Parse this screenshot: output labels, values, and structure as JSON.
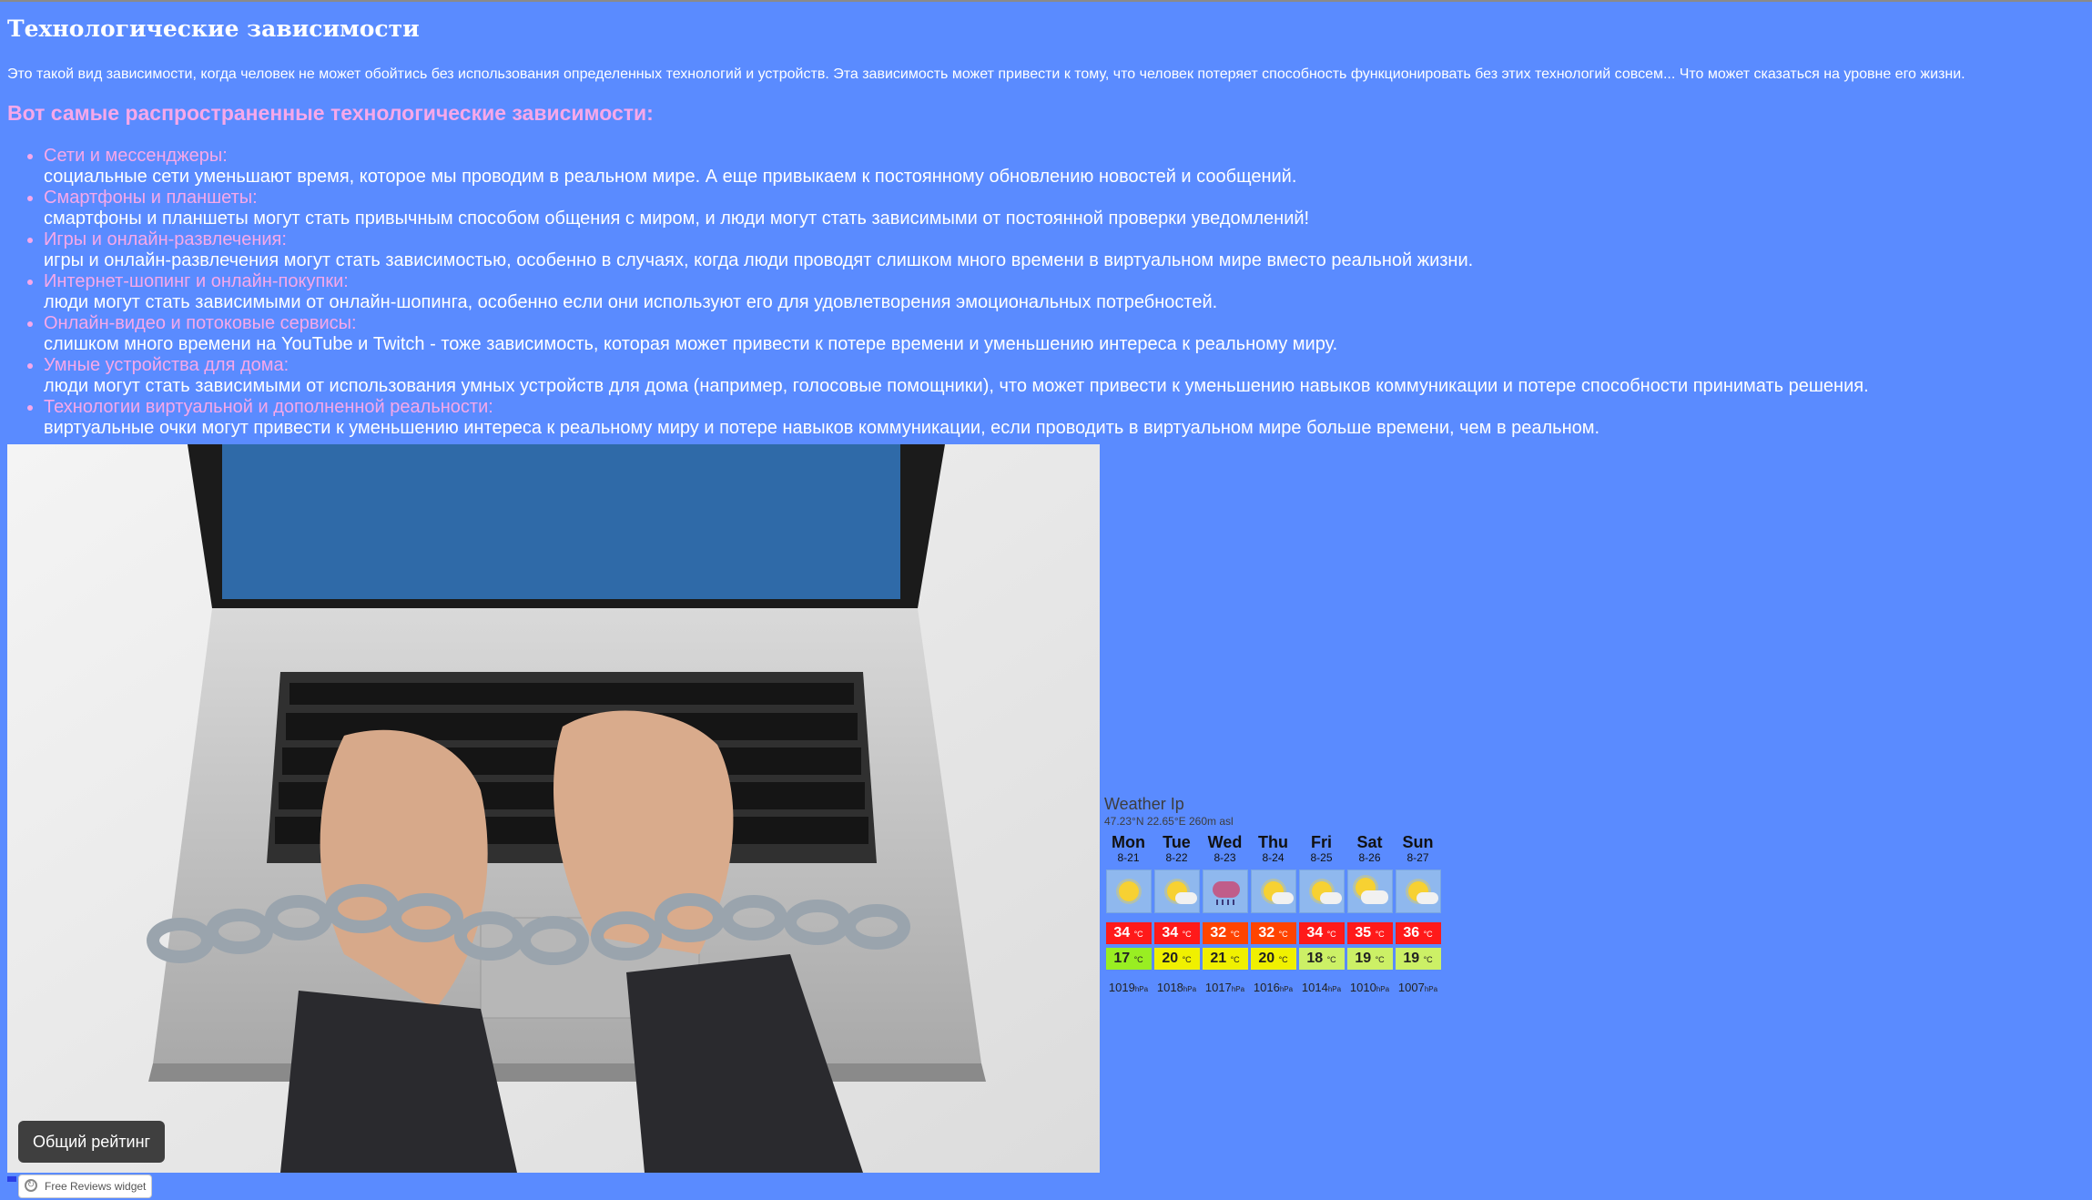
{
  "page": {
    "title": "Технологические зависимости",
    "intro": "Это такой вид зависимости, когда человек не может обойтись без использования определенных технологий и устройств. Эта зависимость может привести к тому, что человек потеряет способность функционировать без этих технологий совсем... Что может сказаться на уровне его жизни.",
    "subtitle": "Вот самые распространенные технологические зависимости:"
  },
  "dependencies": [
    {
      "category": "Сети и мессенджеры:",
      "description": "социальные сети уменьшают время, которое мы проводим в реальном мире. А еще привыкаем к постоянному обновлению новостей и сообщений."
    },
    {
      "category": "Смартфоны и планшеты:",
      "description": "смартфоны и планшеты могут стать привычным способом общения с миром, и люди могут стать зависимыми от постоянной проверки уведомлений!"
    },
    {
      "category": "Игры и онлайн-развлечения:",
      "description": "игры и онлайн-развлечения могут стать зависимостью, особенно в случаях, когда люди проводят слишком много времени в виртуальном мире вместо реальной жизни."
    },
    {
      "category": "Интернет-шопинг и онлайн-покупки:",
      "description": "люди могут стать зависимыми от онлайн-шопинга, особенно если они используют его для удовлетворения эмоциональных потребностей."
    },
    {
      "category": "Онлайн-видео и потоковые сервисы:",
      "description": "слишком много времени на YouTube и Twitch - тоже зависимость, которая может привести к потере времени и уменьшению интереса к реальному миру."
    },
    {
      "category": "Умные устройства для дома:",
      "description": "люди могут стать зависимыми от использования умных устройств для дома (например, голосовые помощники), что может привести к уменьшению навыков коммуникации и потере способности принимать решения."
    },
    {
      "category": "Технологии виртуальной и дополненной реальности:",
      "description": "виртуальные очки могут привести к уменьшению интереса к реальному миру и потере навыков коммуникации, если проводить в виртуальном мире больше времени, чем в реальном."
    }
  ],
  "reviews": {
    "rating_button": "Общий рейтинг",
    "badge": "Free Reviews widget"
  },
  "weather": {
    "title": "Weather Ip",
    "coords": "47.23°N 22.65°E 260m asl",
    "temp_unit": "°C",
    "pressure_unit": "hPa",
    "days": [
      {
        "day": "Mon",
        "date": "8-21",
        "icon": "sunny-icon",
        "max": "34",
        "min": "17",
        "pressure": "1019",
        "max_color": "#ff1a1a",
        "min_color": "#99ee22"
      },
      {
        "day": "Tue",
        "date": "8-22",
        "icon": "partly-cloudy-icon",
        "max": "34",
        "min": "20",
        "pressure": "1018",
        "max_color": "#ff1a1a",
        "min_color": "#f0f000"
      },
      {
        "day": "Wed",
        "date": "8-23",
        "icon": "thunderstorm-icon",
        "max": "32",
        "min": "21",
        "pressure": "1017",
        "max_color": "#ff4400",
        "min_color": "#f0f000"
      },
      {
        "day": "Thu",
        "date": "8-24",
        "icon": "partly-cloudy-icon",
        "max": "32",
        "min": "20",
        "pressure": "1016",
        "max_color": "#ff4400",
        "min_color": "#f0f000"
      },
      {
        "day": "Fri",
        "date": "8-25",
        "icon": "partly-cloudy-icon",
        "max": "34",
        "min": "18",
        "pressure": "1014",
        "max_color": "#ff1a1a",
        "min_color": "#ccf066"
      },
      {
        "day": "Sat",
        "date": "8-26",
        "icon": "cloudy-sun-icon",
        "max": "35",
        "min": "19",
        "pressure": "1010",
        "max_color": "#ff1a1a",
        "min_color": "#ccf066"
      },
      {
        "day": "Sun",
        "date": "8-27",
        "icon": "partly-cloudy-icon",
        "max": "36",
        "min": "19",
        "pressure": "1007",
        "max_color": "#ff1a1a",
        "min_color": "#ccf066"
      }
    ]
  },
  "colors": {
    "background": "#5a8bff",
    "accent_pink": "#f6a8ea"
  }
}
